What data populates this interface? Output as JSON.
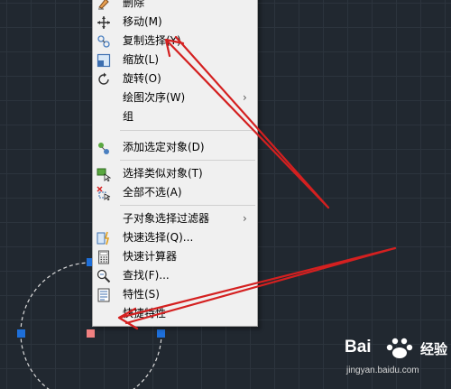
{
  "context_menu": {
    "items": [
      {
        "label": "删除",
        "icon": "eraser-icon"
      },
      {
        "label": "移动(M)",
        "icon": "move-cross-icon"
      },
      {
        "label": "复制选择(Y)",
        "icon": "copy-objects-icon"
      },
      {
        "label": "缩放(L)",
        "icon": "scale-icon"
      },
      {
        "label": "旋转(O)",
        "icon": "rotate-icon"
      },
      {
        "label": "绘图次序(W)",
        "icon": "",
        "submenu": true
      },
      {
        "label": "组",
        "icon": ""
      },
      {
        "label": "添加选定对象(D)",
        "icon": "add-selected-icon"
      },
      {
        "label": "选择类似对象(T)",
        "icon": "select-similar-icon"
      },
      {
        "label": "全部不选(A)",
        "icon": "deselect-all-icon"
      },
      {
        "label": "子对象选择过滤器",
        "icon": "",
        "submenu": true
      },
      {
        "label": "快速选择(Q)...",
        "icon": "quick-select-icon"
      },
      {
        "label": "快速计算器",
        "icon": "calculator-icon"
      },
      {
        "label": "查找(F)...",
        "icon": "find-icon"
      },
      {
        "label": "特性(S)",
        "icon": "properties-icon"
      },
      {
        "label": "快捷特性",
        "icon": ""
      }
    ],
    "submenu_arrow": "›"
  },
  "watermark": {
    "brand": "Bai",
    "brand_suffix": "经验",
    "url": "jingyan.baidu.com"
  },
  "colors": {
    "canvas_bg": "#212830",
    "menu_bg": "#f0f0f0",
    "grip_blue": "#1e6fd9",
    "grip_selected": "#f08080",
    "arrow_red": "#d42020",
    "circle_dashed": "#dcdcdc"
  }
}
